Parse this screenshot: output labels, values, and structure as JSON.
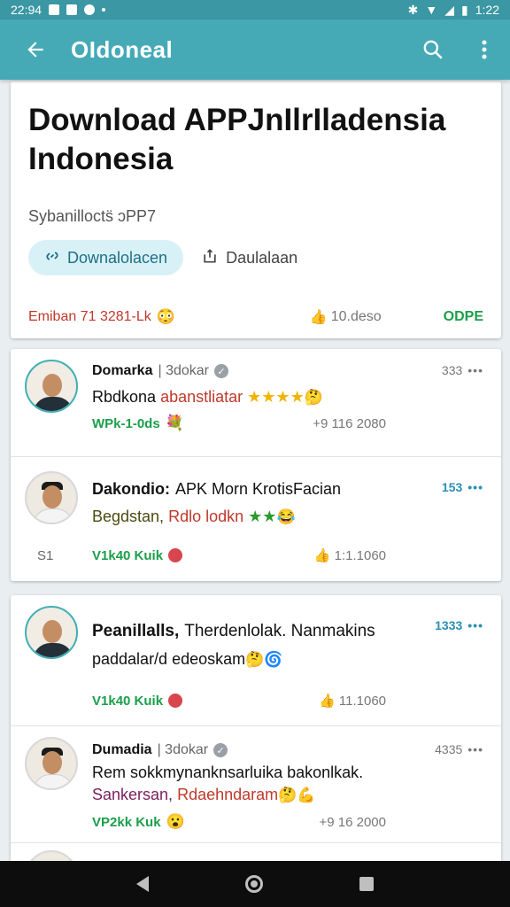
{
  "status": {
    "time_left": "22:94",
    "time_right": "1:22"
  },
  "appbar": {
    "title": "OIdoneal"
  },
  "hero": {
    "title": "Download APPJnIlrIladensia Indonesia",
    "subtitle": "Sybanillocts̈ ɔPP7",
    "download_label": "Downalolacen",
    "secondary_label": "Daulalaan",
    "meta_left": "Emiban 71 3281-Lk",
    "meta_views": "10.deso",
    "meta_right": "ODPE"
  },
  "posts": [
    {
      "name": "Domarka",
      "handle": "| 3dokar",
      "time": "333",
      "line1": "Rbdkona",
      "line1b": "abanstliatar",
      "line1_stars": "★★★★",
      "stat_label": "WPk-1-0ds",
      "stat_count": "+9 116 2080"
    },
    {
      "name": "Dakondio:",
      "headline": "APK Morn KrotisFacian",
      "time": "153",
      "line2a": "Begdstan,",
      "line2b": "Rdlo lodkn",
      "line2_stars": "★★",
      "stat_far": "S1",
      "stat_label": "V1k40 Kuik",
      "stat_count": "1:1.1060"
    },
    {
      "name": "Peanillalls,",
      "headline": "Therdenlolak. Nanmakins",
      "time": "1333",
      "line2": "paddalar/d edeoskam",
      "stat_label": "V1k40 Kuik",
      "stat_count": "11.1060"
    },
    {
      "name": "Dumadia",
      "handle": "| 3dokar",
      "time": "4335",
      "line1": "Rem sokkmynanknsarluika bakonlkak.",
      "line2a": "Sankersan,",
      "line2b": "Rdaehndaram",
      "stat_label": "VP2kk Kuk",
      "stat_count": "+9 16 2000"
    }
  ],
  "icons": {
    "back": "arrow-left-icon",
    "search": "search-icon",
    "more": "more-vert-icon",
    "download": "link-icon",
    "share": "share-icon",
    "like": "thumb-icon"
  },
  "colors": {
    "appbar": "#45aab6",
    "statusbar": "#3a97a3",
    "accent_green": "#1b9e4b",
    "accent_red": "#c0392b"
  }
}
